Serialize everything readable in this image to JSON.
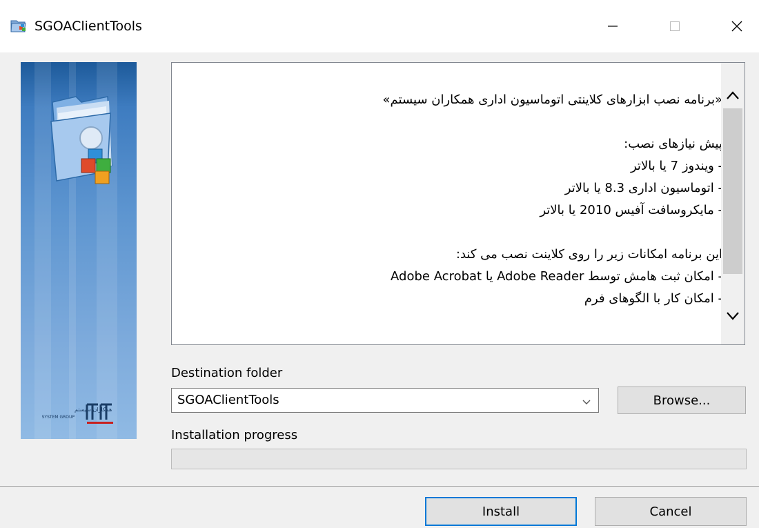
{
  "window": {
    "title": "SGOAClientTools",
    "icon": "installer-app-icon",
    "controls": [
      "minimize-icon",
      "maximize-icon",
      "close-icon"
    ]
  },
  "banner": {
    "image": "folder-with-cubes-illustration",
    "logo_fa": "همکاران سیستم",
    "logo_en": "SYSTEM GROUP"
  },
  "readme": {
    "lines": [
      "«برنامه نصب ابزارهای کلاینتی اتوماسیون اداری همکاران سیستم»",
      "",
      "پیش نیازهای نصب:",
      "- ویندوز 7 یا بالاتر",
      "- اتوماسیون اداری  8.3 یا بالاتر",
      "- مایکروسافت آفیس 2010 یا بالاتر",
      "",
      "این برنامه امکانات زیر را روی کلاینت نصب می کند:",
      "- امکان ثبت هامش توسط Adobe Reader یا Adobe Acrobat",
      "- امکان کار با الگوهای فرم"
    ]
  },
  "destination": {
    "label": "Destination folder",
    "value": "SGOAClientTools"
  },
  "browse_label": "Browse...",
  "progress": {
    "label": "Installation progress",
    "value": 0
  },
  "buttons": {
    "install": "Install",
    "cancel": "Cancel"
  },
  "colors": {
    "accent": "#0078d7",
    "banner_top": "#1d5a9a",
    "banner_bottom": "#90bae4"
  }
}
